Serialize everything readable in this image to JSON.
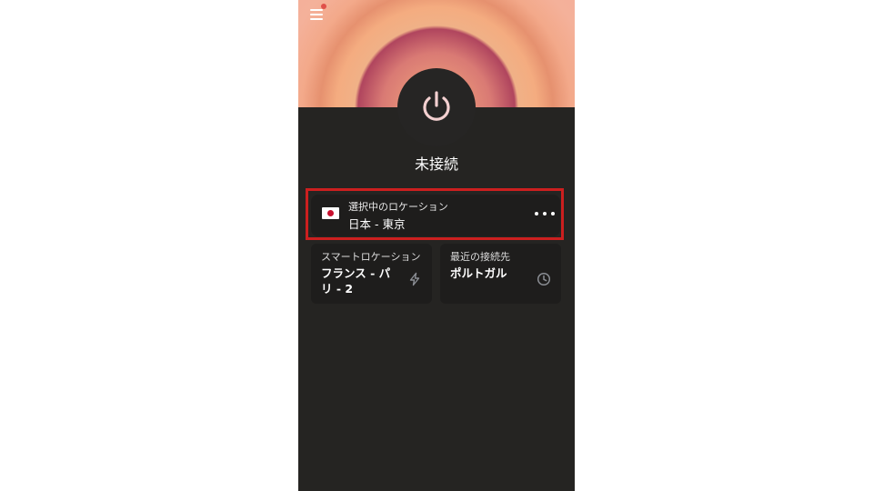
{
  "app": {
    "status_text": "未接続"
  },
  "current_location": {
    "label": "選択中のロケーション",
    "value": "日本 - 東京",
    "flag_icon": "japan-flag-icon"
  },
  "smart_location": {
    "label": "スマートロケーション",
    "value": "フランス - パリ - 2",
    "icon": "lightning-icon"
  },
  "recent_location": {
    "label": "最近の接続先",
    "value": "ポルトガル",
    "icon": "clock-icon"
  },
  "colors": {
    "background": "#252422",
    "card": "#1e1d1c",
    "highlight": "#cc1f1f",
    "accent_pink": "#f0c8c8",
    "hero_orange": "#f2a47c"
  }
}
